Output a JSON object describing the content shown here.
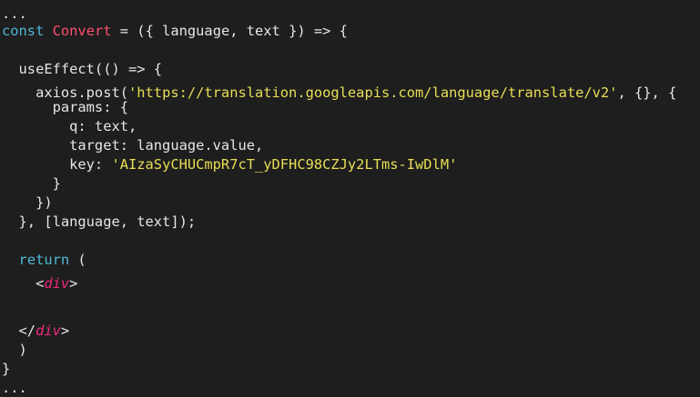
{
  "colors": {
    "background": "#1e1e1e",
    "plain": "#e6e6e6",
    "keyword": "#4fb8d6",
    "function_name": "#ff4f6e",
    "string": "#e9df55",
    "jsx_tag": "#f0287e"
  },
  "code": {
    "lines": [
      {
        "tokens": [
          {
            "t": "plain",
            "text": "..."
          }
        ]
      },
      {
        "tokens": [
          {
            "t": "kw",
            "text": "const"
          },
          {
            "t": "plain",
            "text": " "
          },
          {
            "t": "fn",
            "text": "Convert"
          },
          {
            "t": "plain",
            "text": " = ({ language, text }) => {"
          }
        ]
      },
      {
        "tokens": []
      },
      {
        "tokens": [
          {
            "t": "plain",
            "text": "  useEffect(() => {"
          }
        ]
      },
      {
        "tokens": [
          {
            "t": "plain",
            "text": "    axios.post("
          },
          {
            "t": "str",
            "text": "'https://translation.googleapis.com/language/translate/v2'"
          },
          {
            "t": "plain",
            "text": ", {}, {"
          }
        ]
      },
      {
        "tokens": [
          {
            "t": "plain",
            "text": "      params: {"
          }
        ]
      },
      {
        "tokens": [
          {
            "t": "plain",
            "text": "        q: text,"
          }
        ]
      },
      {
        "tokens": [
          {
            "t": "plain",
            "text": "        target: language.value,"
          }
        ]
      },
      {
        "tokens": [
          {
            "t": "plain",
            "text": "        key: "
          },
          {
            "t": "str",
            "text": "'AIzaSyCHUCmpR7cT_yDFHC98CZJy2LTms-IwDlM'"
          }
        ]
      },
      {
        "tokens": [
          {
            "t": "plain",
            "text": "      }"
          }
        ]
      },
      {
        "tokens": [
          {
            "t": "plain",
            "text": "    })"
          }
        ]
      },
      {
        "tokens": [
          {
            "t": "plain",
            "text": "  }, [language, text]);"
          }
        ]
      },
      {
        "tokens": []
      },
      {
        "tokens": [
          {
            "t": "plain",
            "text": "  "
          },
          {
            "t": "kw",
            "text": "return"
          },
          {
            "t": "plain",
            "text": " ("
          }
        ]
      },
      {
        "tokens": [
          {
            "t": "plain",
            "text": "    <"
          },
          {
            "t": "tag",
            "text": "div"
          },
          {
            "t": "plain",
            "text": ">"
          }
        ]
      },
      {
        "tokens": []
      },
      {
        "tokens": [
          {
            "t": "plain",
            "text": "  </"
          },
          {
            "t": "tag",
            "text": "div"
          },
          {
            "t": "plain",
            "text": ">"
          }
        ]
      },
      {
        "tokens": [
          {
            "t": "plain",
            "text": "  )"
          }
        ]
      },
      {
        "tokens": [
          {
            "t": "plain",
            "text": "}"
          }
        ]
      },
      {
        "tokens": [
          {
            "t": "plain",
            "text": "..."
          }
        ]
      }
    ]
  }
}
